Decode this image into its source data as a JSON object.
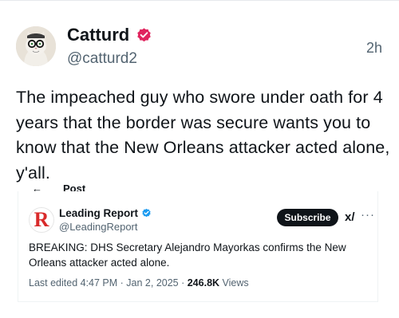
{
  "post": {
    "author_name": "Catturd",
    "handle": "@catturd2",
    "time": "2h",
    "text": "The impeached guy who swore under oath for 4 years that the border was secure wants you to know that the New Orleans attacker acted alone, y'all."
  },
  "quoted": {
    "header_label": "Post",
    "author_name": "Leading Report",
    "handle": "@LeadingReport",
    "avatar_letter": "R",
    "subscribe_label": "Subscribe",
    "grok_label": "x/",
    "more_label": "···",
    "text": "BREAKING: DHS Secretary Alejandro Mayorkas confirms the New Orleans attacker acted alone.",
    "edited": "Last edited 4:47 PM · Jan 2, 2025 · ",
    "views_count": "246.8K",
    "views_label": "Views"
  },
  "colors": {
    "verified_badge": "#e0245e",
    "quoted_verified_badge": "#1d9bf0",
    "quoted_avatar_letter": "#d92a2a"
  },
  "icons": {
    "main_avatar": "cat-with-glasses-avatar",
    "verified": "verified-badge-icon",
    "back": "back-arrow-icon"
  }
}
